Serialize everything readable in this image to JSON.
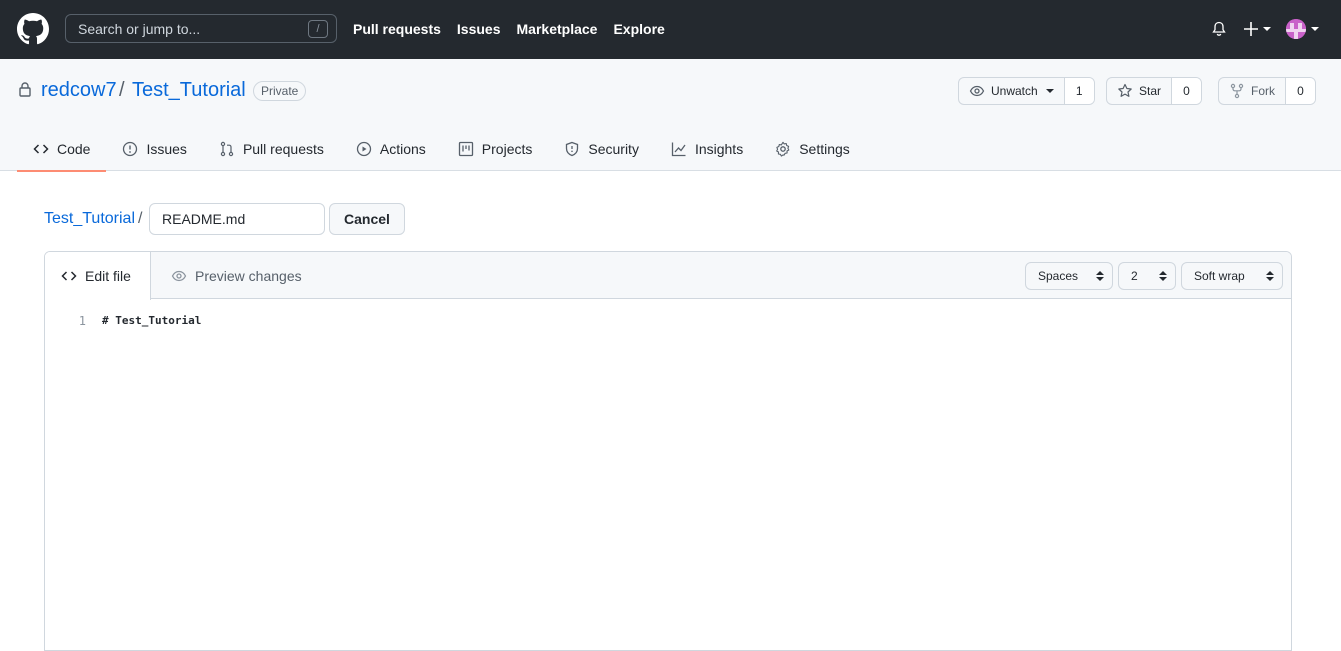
{
  "header": {
    "search_placeholder": "Search or jump to...",
    "search_shortcut": "/",
    "nav": [
      "Pull requests",
      "Issues",
      "Marketplace",
      "Explore"
    ]
  },
  "repo": {
    "owner": "redcow7",
    "separator": "/",
    "name": "Test_Tutorial",
    "visibility": "Private",
    "watch_label": "Unwatch",
    "watch_count": "1",
    "star_label": "Star",
    "star_count": "0",
    "fork_label": "Fork",
    "fork_count": "0"
  },
  "tabs": [
    {
      "label": "Code",
      "icon": "code-icon",
      "active": true
    },
    {
      "label": "Issues",
      "icon": "issue-icon"
    },
    {
      "label": "Pull requests",
      "icon": "pull-request-icon"
    },
    {
      "label": "Actions",
      "icon": "play-icon"
    },
    {
      "label": "Projects",
      "icon": "project-icon"
    },
    {
      "label": "Security",
      "icon": "shield-icon"
    },
    {
      "label": "Insights",
      "icon": "graph-icon"
    },
    {
      "label": "Settings",
      "icon": "gear-icon"
    }
  ],
  "edit": {
    "breadcrumb_repo": "Test_Tutorial",
    "breadcrumb_sep": "/",
    "filename": "README.md",
    "cancel_label": "Cancel",
    "edit_tab": "Edit file",
    "preview_tab": "Preview changes",
    "indent_mode": "Spaces",
    "indent_size": "2",
    "wrap_mode": "Soft wrap",
    "lines": [
      {
        "num": "1",
        "text": "# Test_Tutorial"
      }
    ]
  },
  "colors": {
    "header_bg": "#24292f",
    "link": "#0969da",
    "active_tab_underline": "#fd8c73"
  }
}
